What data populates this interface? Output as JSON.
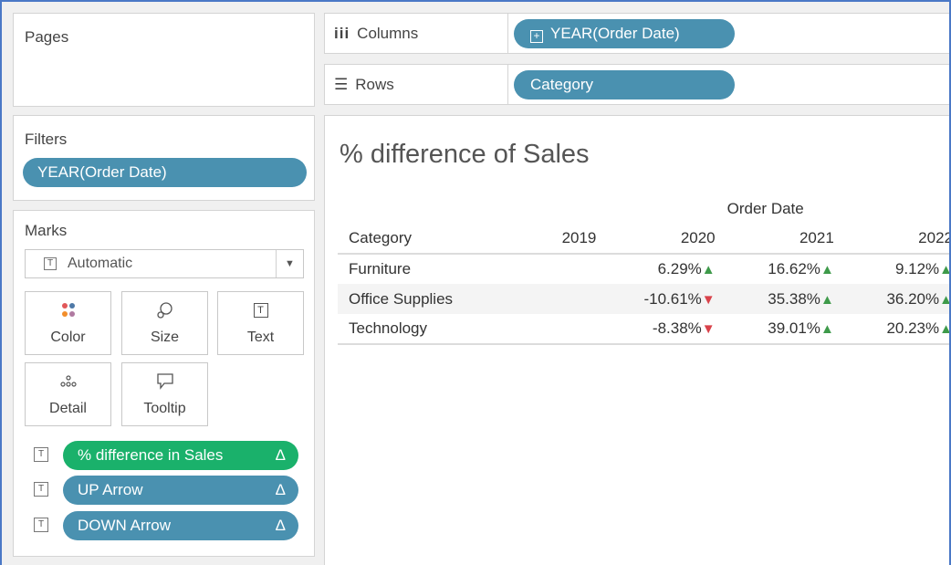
{
  "pages": {
    "title": "Pages"
  },
  "columns": {
    "label": "Columns",
    "pill_label": "YEAR(Order Date)"
  },
  "rows": {
    "label": "Rows",
    "pill_label": "Category"
  },
  "filters": {
    "title": "Filters",
    "pill_label": "YEAR(Order Date)"
  },
  "marks": {
    "title": "Marks",
    "mark_type": "Automatic",
    "buttons": {
      "color": "Color",
      "size": "Size",
      "text": "Text",
      "detail": "Detail",
      "tooltip": "Tooltip"
    },
    "fields": [
      {
        "label": "% difference in Sales",
        "delta": "Δ",
        "color": "#1ab16b"
      },
      {
        "label": "UP Arrow",
        "delta": "Δ",
        "color": "#4a91b0"
      },
      {
        "label": "DOWN Arrow",
        "delta": "Δ",
        "color": "#4a91b0"
      }
    ]
  },
  "view": {
    "title": "% difference of Sales",
    "column_group_header": "Order Date",
    "row_header": "Category",
    "years": [
      "2019",
      "2020",
      "2021",
      "2022"
    ],
    "rows": [
      {
        "category": "Furniture",
        "values": [
          "",
          "6.29%",
          "16.62%",
          "9.12%"
        ],
        "arrows": [
          "",
          "▲",
          "▲",
          "▲"
        ]
      },
      {
        "category": "Office Supplies",
        "values": [
          "",
          "-10.61%",
          "35.38%",
          "36.20%"
        ],
        "arrows": [
          "",
          "▼",
          "▲",
          "▲"
        ]
      },
      {
        "category": "Technology",
        "values": [
          "",
          "-8.38%",
          "39.01%",
          "20.23%"
        ],
        "arrows": [
          "",
          "▼",
          "▲",
          "▲"
        ]
      }
    ]
  },
  "colors": {
    "pill": "#4a91b0",
    "pill_green": "#1ab16b",
    "up_arrow": "#3e9a4a",
    "down_arrow": "#d9424a"
  }
}
